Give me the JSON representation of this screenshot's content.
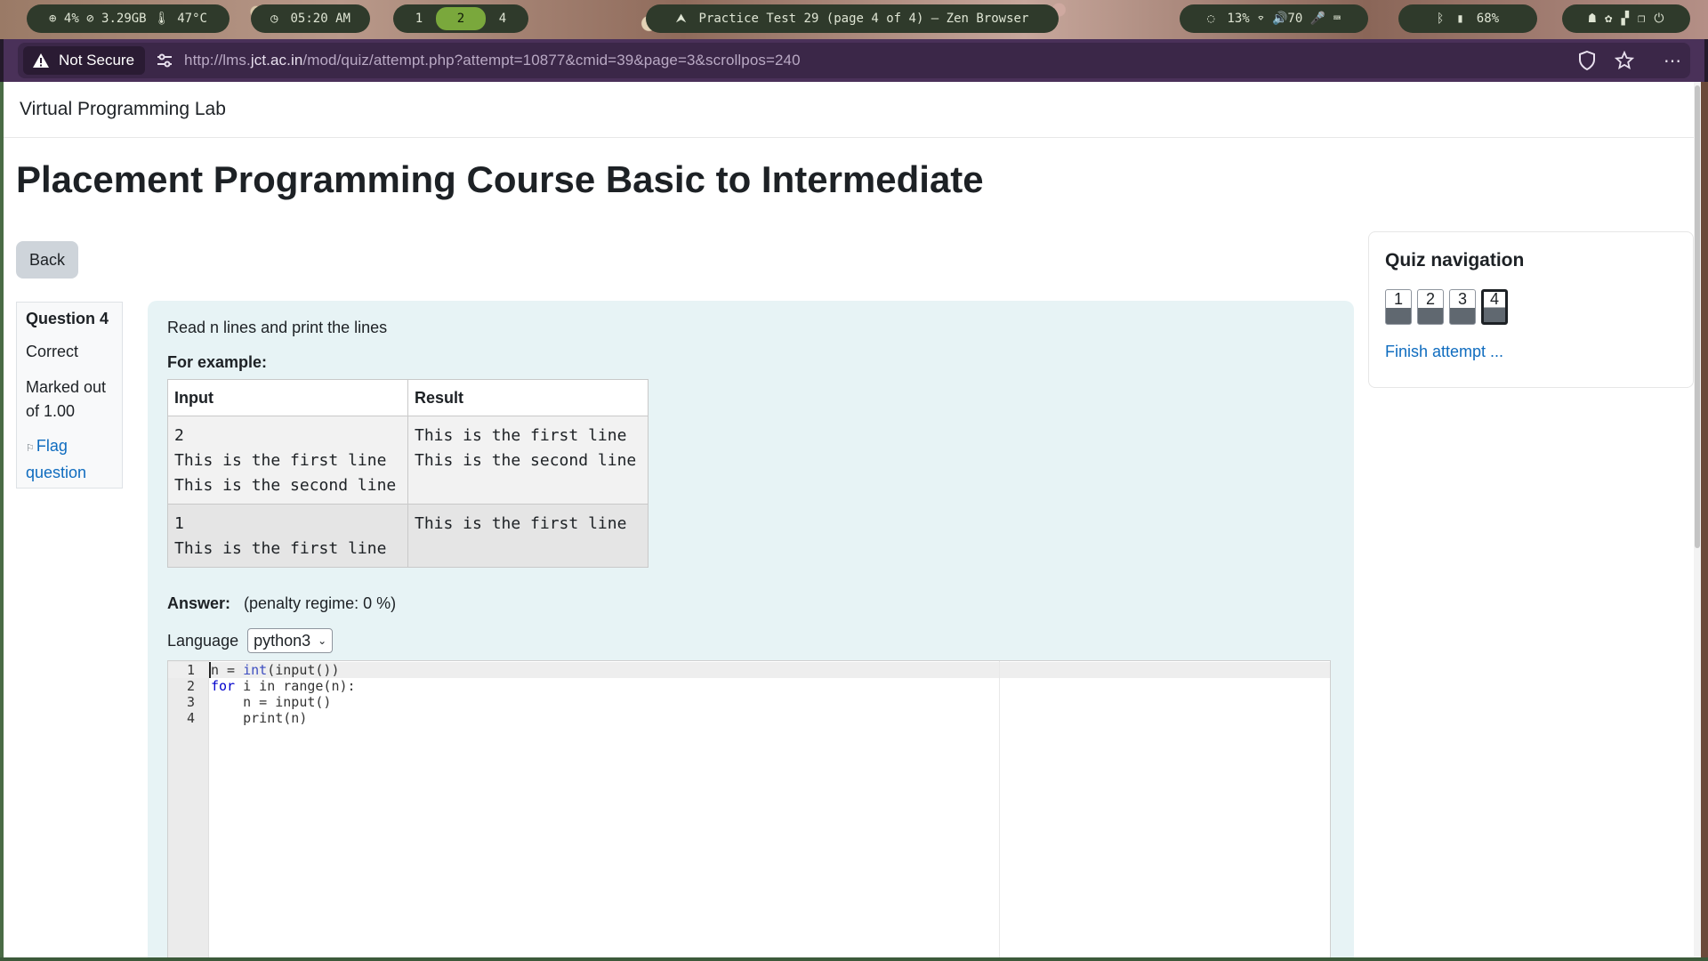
{
  "system_bar": {
    "stats": "⊕ 4%  ⊘ 3.29GB  🌡 47°C",
    "clock": "05:20 AM",
    "workspaces": [
      "1",
      "2",
      "4"
    ],
    "active_workspace": "2",
    "window_title": "Practice Test 29 (page 4 of 4) — Zen Browser",
    "system_status": "13%  ⌔  🔊70  🎤  ⌨",
    "battery": "68%",
    "accent_color": "#7aa83c"
  },
  "browser": {
    "security_label": "Not Secure",
    "url_prefix": "http://lms.",
    "url_domain": "jct.ac.in",
    "url_path": "/mod/quiz/attempt.php?attempt=10877&cmid=39&page=3&scrollpos=240"
  },
  "page": {
    "site_name": "Virtual Programming Lab",
    "course_title": "Placement Programming Course Basic to Intermediate",
    "back_label": "Back"
  },
  "question_info": {
    "number_label": "Question 4",
    "state": "Correct",
    "grade": "Marked out of 1.00",
    "flag_label": "Flag question"
  },
  "question": {
    "text": "Read n lines and print the lines",
    "example_label": "For example:",
    "table_headers": [
      "Input",
      "Result"
    ],
    "rows": [
      {
        "input": "2\nThis is the first line\nThis is the second line",
        "result": "This is the first line\nThis is the second line"
      },
      {
        "input": "1\nThis is the first line",
        "result": "This is the first line"
      }
    ],
    "answer_label": "Answer:",
    "penalty_text": "(penalty regime: 0 %)",
    "language_label": "Language",
    "language_value": "python3"
  },
  "editor": {
    "lines": [
      {
        "num": "1",
        "code": "n = int(input())"
      },
      {
        "num": "2",
        "code": "for i in range(n):"
      },
      {
        "num": "3",
        "code": "    n = input()"
      },
      {
        "num": "4",
        "code": "    print(n)"
      }
    ]
  },
  "quiz_nav": {
    "title": "Quiz navigation",
    "pages": [
      "1",
      "2",
      "3",
      "4"
    ],
    "current_page": "4",
    "finish_label": "Finish attempt ..."
  }
}
